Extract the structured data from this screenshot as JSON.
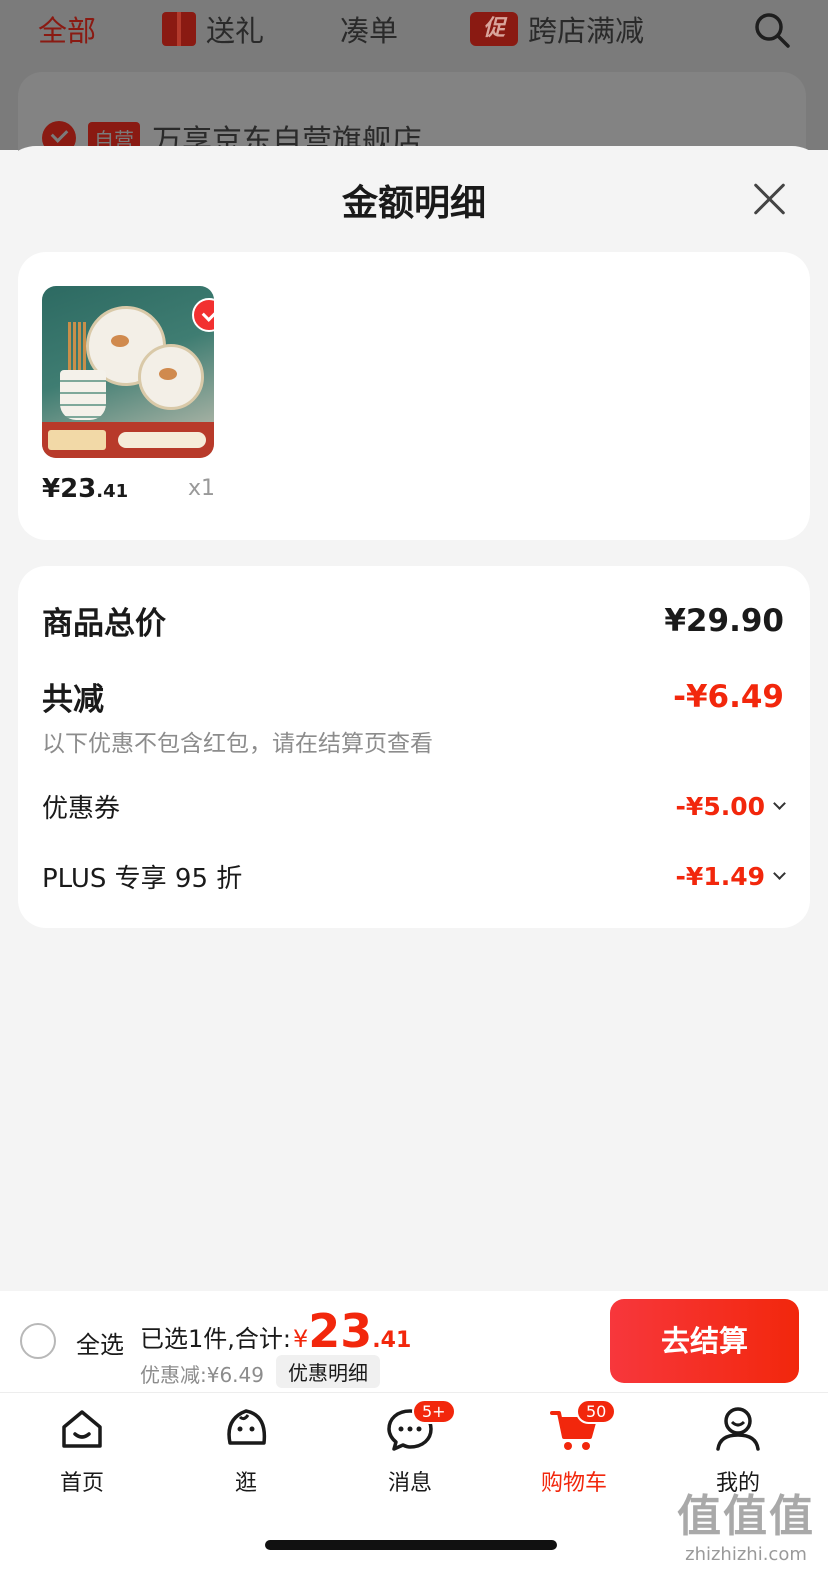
{
  "background": {
    "tabs": [
      {
        "label": "全部",
        "active": true
      },
      {
        "label": "送礼",
        "icon": "gift-icon"
      },
      {
        "label": "凑单"
      },
      {
        "label": "跨店满减",
        "badge": "促"
      }
    ],
    "store": {
      "badge": "自营",
      "name": "万享京东自营旗舰店"
    }
  },
  "sheet": {
    "title": "金额明细",
    "item": {
      "price_int": "¥23",
      "price_dec": ".41",
      "qty": "x1",
      "selected": true
    },
    "summary": {
      "total_label": "商品总价",
      "total_value": "¥29.90",
      "reduce_label": "共减",
      "reduce_value": "-¥6.49",
      "hint": "以下优惠不包含红包，请在结算页查看",
      "coupon_label": "优惠券",
      "coupon_value": "-¥5.00",
      "plus_label": "PLUS 专享 95 折",
      "plus_value": "-¥1.49"
    }
  },
  "cart_bar": {
    "select_all": "全选",
    "selected_text": "已选1件,合计:",
    "currency": "¥",
    "total_int": "23",
    "total_dec": ".41",
    "discount_text": "优惠减:¥6.49",
    "detail_link": "优惠明细",
    "checkout": "去结算"
  },
  "tabbar": [
    {
      "label": "首页",
      "icon": "home-icon"
    },
    {
      "label": "逛",
      "icon": "explore-icon"
    },
    {
      "label": "消息",
      "icon": "message-icon",
      "badge": "5+"
    },
    {
      "label": "购物车",
      "icon": "cart-icon",
      "badge": "50",
      "active": true
    },
    {
      "label": "我的",
      "icon": "profile-icon"
    }
  ],
  "watermark": {
    "logo": "值值值",
    "site": "zhizhizhi.com"
  },
  "colors": {
    "accent": "#f2270c",
    "sheet_bg": "#f4f4f4",
    "dim_bg": "#7b7b7b"
  }
}
